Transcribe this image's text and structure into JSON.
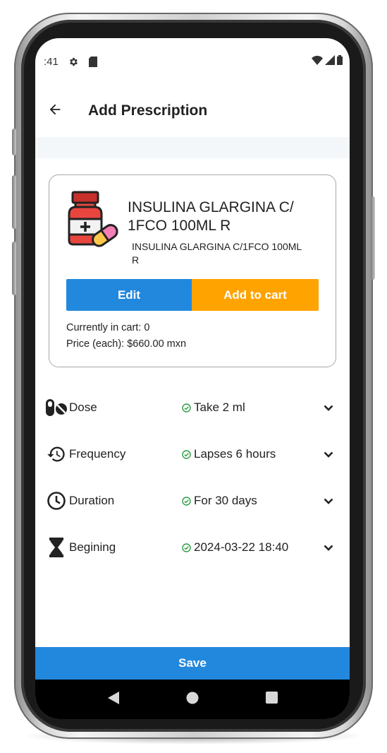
{
  "status_bar": {
    "time": ":41",
    "icons": [
      "gear-icon",
      "sd-card-icon",
      "wifi-icon",
      "signal-icon",
      "battery-icon"
    ]
  },
  "header": {
    "back_icon": "arrow-left-icon",
    "title": "Add Prescription"
  },
  "medication": {
    "icon": "medicine-bottle-pill-icon",
    "name": "INSULINA GLARGINA C/ 1FCO 100ML R",
    "description": "INSULINA GLARGINA C/1FCO 100ML R",
    "edit_label": "Edit",
    "add_to_cart_label": "Add to cart",
    "cart_count_text": "Currently in cart: 0",
    "price_text": "Price (each): $660.00 mxn"
  },
  "details": [
    {
      "icon": "pill-no-icon",
      "label": "Dose",
      "value": "Take 2 ml"
    },
    {
      "icon": "history-icon",
      "label": "Frequency",
      "value": "Lapses 6 hours"
    },
    {
      "icon": "clock-icon",
      "label": "Duration",
      "value": "For 30 days"
    },
    {
      "icon": "hourglass-icon",
      "label": "Begining",
      "value": "2024-03-22 18:40"
    }
  ],
  "save_label": "Save",
  "nav": [
    "back-triangle-icon",
    "home-circle-icon",
    "recents-square-icon"
  ],
  "colors": {
    "primary": "#2288dd",
    "accent": "#ffa300",
    "check": "#2e9e44"
  }
}
